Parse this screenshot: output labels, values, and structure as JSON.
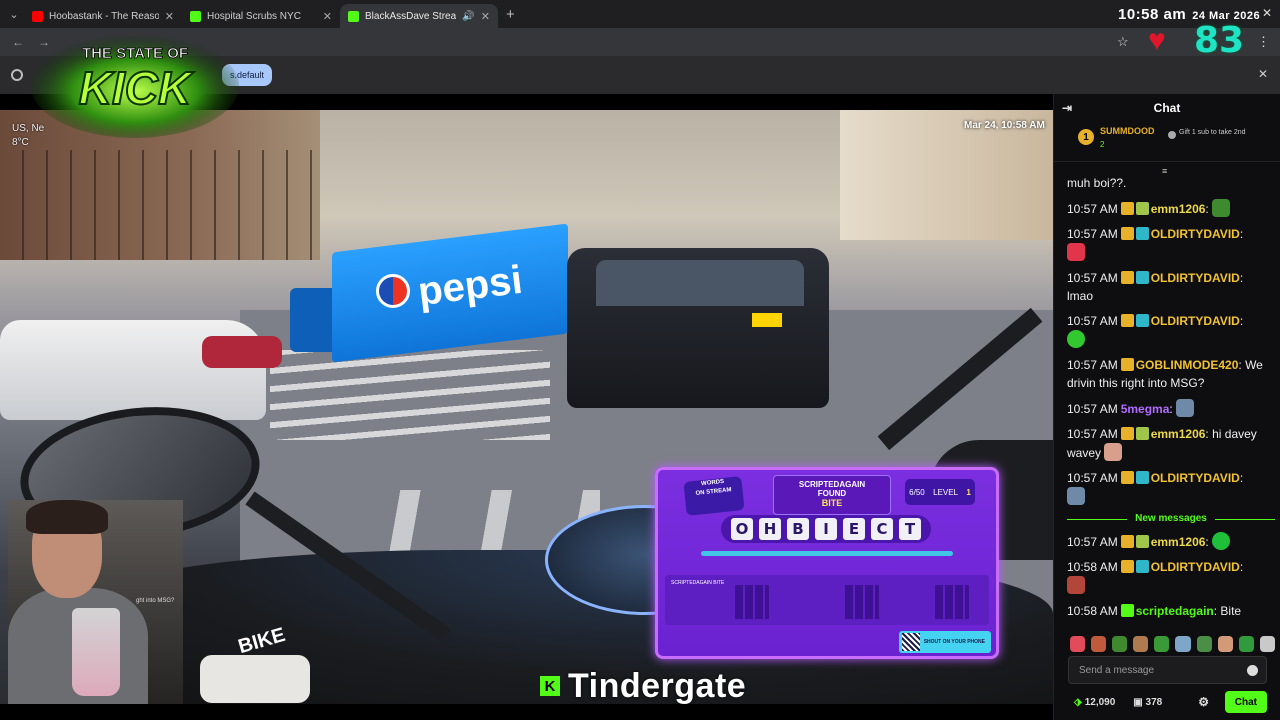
{
  "browser": {
    "tabs": [
      {
        "title": "Hoobastank - The Reason (Lyric",
        "favicon_color": "#ff0000",
        "active": false,
        "audio": false
      },
      {
        "title": "Hospital Scrubs NYC",
        "favicon_color": "#53fc18",
        "active": false,
        "audio": false
      },
      {
        "title": "BlackAssDave Stream - Wa",
        "favicon_color": "#53fc18",
        "active": true,
        "audio": true
      }
    ],
    "new_tab": "+",
    "info_chip": "s.default",
    "clock_time": "10:58 am",
    "clock_date": "24 Mar 2026"
  },
  "overlay": {
    "logo_line1": "THE STATE OF",
    "logo_line2": "KICK",
    "heart_count": "83",
    "caption_badge": "K",
    "caption_text": "Tindergate",
    "webcam_caption": "ght into MSG?"
  },
  "video": {
    "location_line1": "US, Ne",
    "location_line2": "8°C",
    "timestamp": "Mar 24, 10:58 AM",
    "truck_text": "pepsi",
    "bike_text": "BIKE"
  },
  "words_on_stream": {
    "logo_top": "WORDS",
    "logo_bottom": "ON STREAM",
    "found_user": "SCRIPTEDAGAIN",
    "found_label": "FOUND",
    "found_word": "BITE",
    "progress": "6/50",
    "level_label": "LEVEL",
    "level": "1",
    "letters": [
      "O",
      "H",
      "B",
      "I",
      "E",
      "C",
      "T"
    ],
    "board_user": "SCRIPTEDAGAIN",
    "board_word": "BITE",
    "qr_text": "SHOUT ON YOUR PHONE"
  },
  "chat": {
    "title": "Chat",
    "pinned_user": "SUMMDOOD",
    "pinned_rank": "1",
    "pinned_subs": "2",
    "pinned_msg": "Gift 1 sub to take 2nd",
    "messages": [
      {
        "time": "",
        "user": "",
        "color": "#efeff1",
        "text": "muh boi??."
      },
      {
        "time": "10:57 AM",
        "user": "emm1206",
        "color": "#ecd94a",
        "text": ""
      },
      {
        "time": "10:57 AM",
        "user": "OLDIRTYDAVID",
        "color": "#f1c232",
        "text": ""
      },
      {
        "time": "10:57 AM",
        "user": "OLDIRTYDAVID",
        "color": "#f1c232",
        "text": "lmao"
      },
      {
        "time": "10:57 AM",
        "user": "OLDIRTYDAVID",
        "color": "#f1c232",
        "text": ""
      },
      {
        "time": "10:57 AM",
        "user": "GOBLINMODE420",
        "color": "#f1c232",
        "text": "We drivin this right into MSG?"
      },
      {
        "time": "10:57 AM",
        "user": "5megma",
        "color": "#b26bff",
        "text": ""
      },
      {
        "time": "10:57 AM",
        "user": "emm1206",
        "color": "#ecd94a",
        "text": "hi davey wavey"
      },
      {
        "time": "10:57 AM",
        "user": "OLDIRTYDAVID",
        "color": "#f1c232",
        "text": ""
      }
    ],
    "divider": "New messages",
    "new_messages": [
      {
        "time": "10:57 AM",
        "user": "emm1206",
        "color": "#ecd94a",
        "text": ""
      },
      {
        "time": "10:58 AM",
        "user": "OLDIRTYDAVID",
        "color": "#f1c232",
        "text": ""
      },
      {
        "time": "10:58 AM",
        "user": "scriptedagain",
        "color": "#53fc18",
        "text": "Bite"
      }
    ],
    "input_placeholder": "Send a message",
    "points": "12,090",
    "gifts": "378",
    "chat_button": "Chat"
  },
  "colors": {
    "kick_green": "#53fc18",
    "chat_bg": "#0e0e10",
    "wos_purple": "#7b2fe0"
  }
}
